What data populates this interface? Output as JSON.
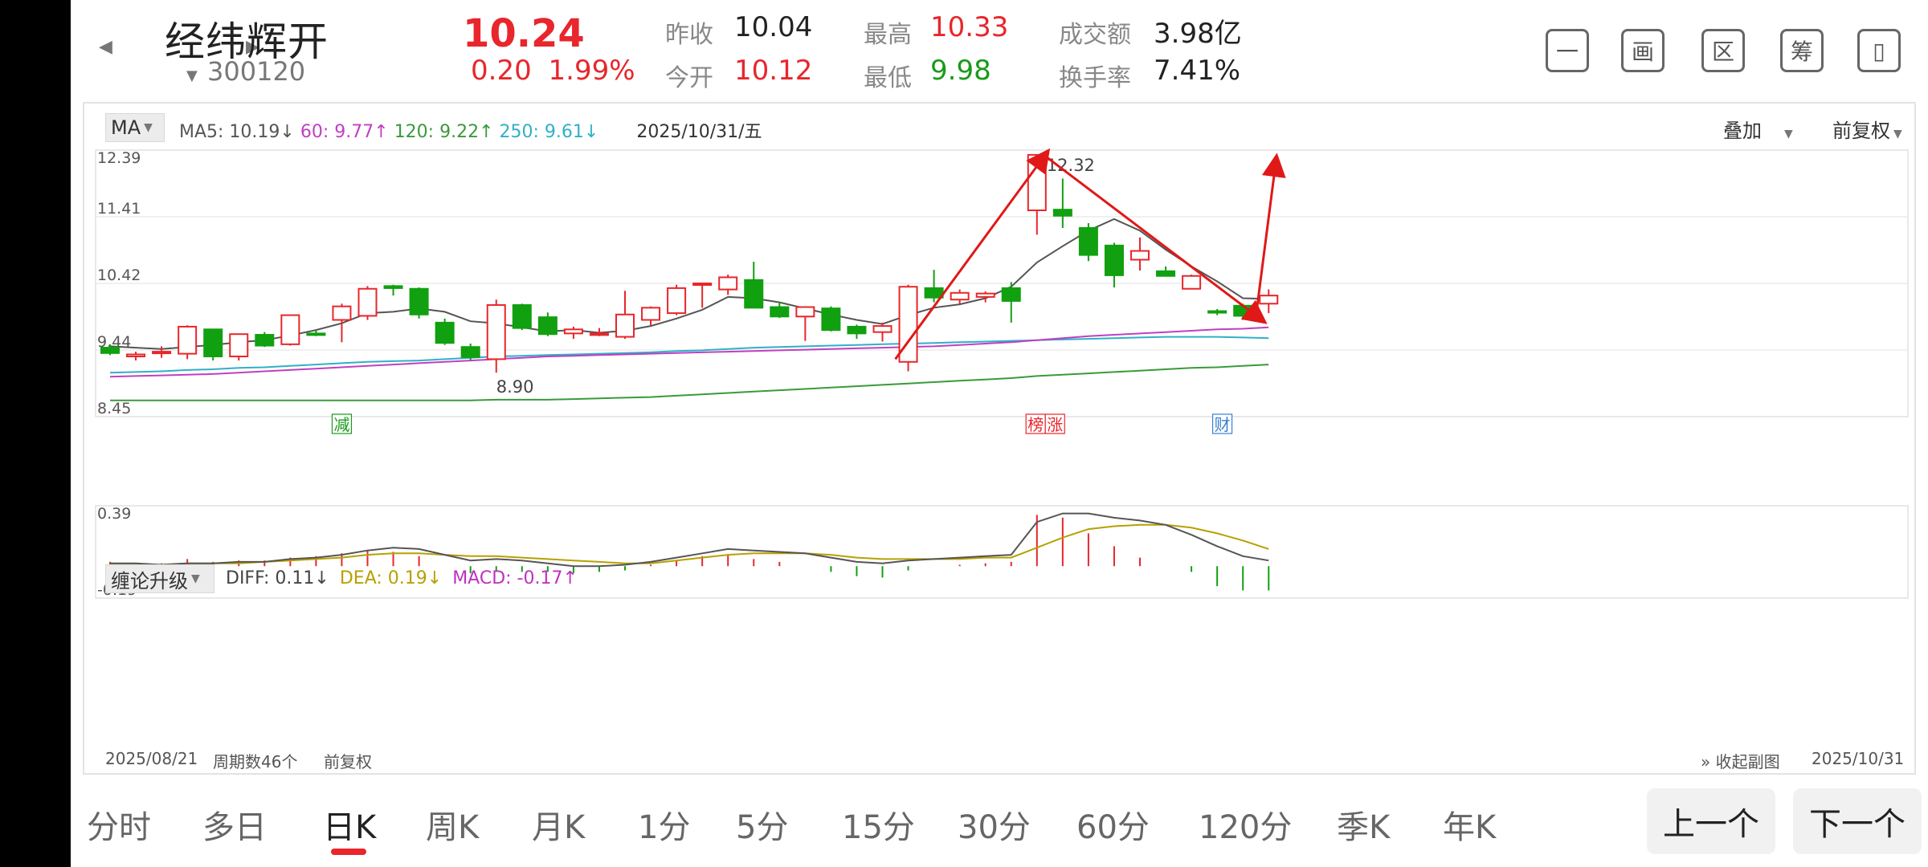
{
  "header": {
    "stock_name": "经纬辉开",
    "stock_code": "300120",
    "price": "10.24",
    "change": "0.20",
    "change_pct": "1.99%",
    "quote": {
      "prev_close_label": "昨收",
      "prev_close": "10.04",
      "open_label": "今开",
      "open": "10.12",
      "high_label": "最高",
      "high": "10.33",
      "low_label": "最低",
      "low": "9.98",
      "turnover_amt_label": "成交额",
      "turnover_amt": "3.98亿",
      "turnover_rate_label": "换手率",
      "turnover_rate": "7.41%"
    },
    "tools": [
      "一",
      "画",
      "区",
      "筹",
      "▯"
    ]
  },
  "chart": {
    "ma_selector": "MA",
    "ma5": "MA5: 10.19↓",
    "ma60": "60: 9.77↑",
    "ma120": "120: 9.22↑",
    "ma250": "250: 9.61↓",
    "date": "2025/10/31/五",
    "overlay_label": "叠加",
    "adjust_label": "前复权",
    "y_labels": [
      "12.39",
      "11.41",
      "10.42",
      "9.44",
      "8.45"
    ],
    "high_marker": "12.32",
    "low_marker": "8.90",
    "events": {
      "reduce": "减",
      "bang": "榜",
      "zhang": "涨",
      "cai": "财"
    },
    "sub_selector": "缠论升级",
    "diff": "DIFF: 0.11↓",
    "dea": "DEA: 0.19↓",
    "macd": "MACD: -0.17↑",
    "macd_top": "0.39",
    "macd_bottom": "-0.19",
    "start_date": "2025/08/21",
    "period_count": "周期数46个",
    "footer_adjust": "前复权",
    "collapse_label": "收起副图",
    "end_date": "2025/10/31"
  },
  "chart_data": {
    "type": "candlestick",
    "ylim": [
      8.45,
      12.39
    ],
    "colors": {
      "up": "#e8262b",
      "down": "#10a010",
      "ma5": "#555555",
      "ma60": "#c040c0",
      "ma120": "#3a9a3a",
      "ma250": "#30b0c8"
    },
    "candles": [
      {
        "o": 9.47,
        "h": 9.52,
        "l": 9.36,
        "c": 9.39
      },
      {
        "o": 9.34,
        "h": 9.41,
        "l": 9.28,
        "c": 9.37
      },
      {
        "o": 9.4,
        "h": 9.49,
        "l": 9.32,
        "c": 9.41
      },
      {
        "o": 9.38,
        "h": 9.8,
        "l": 9.3,
        "c": 9.78
      },
      {
        "o": 9.74,
        "h": 9.75,
        "l": 9.28,
        "c": 9.34
      },
      {
        "o": 9.34,
        "h": 9.68,
        "l": 9.28,
        "c": 9.67
      },
      {
        "o": 9.66,
        "h": 9.7,
        "l": 9.48,
        "c": 9.5
      },
      {
        "o": 9.52,
        "h": 9.96,
        "l": 9.5,
        "c": 9.95
      },
      {
        "o": 9.68,
        "h": 9.73,
        "l": 9.64,
        "c": 9.67
      },
      {
        "o": 9.88,
        "h": 10.12,
        "l": 9.55,
        "c": 10.08
      },
      {
        "o": 9.94,
        "h": 10.38,
        "l": 9.88,
        "c": 10.34
      },
      {
        "o": 10.38,
        "h": 10.4,
        "l": 10.24,
        "c": 10.35
      },
      {
        "o": 10.34,
        "h": 10.36,
        "l": 9.9,
        "c": 9.96
      },
      {
        "o": 9.84,
        "h": 9.9,
        "l": 9.51,
        "c": 9.54
      },
      {
        "o": 9.48,
        "h": 9.53,
        "l": 9.28,
        "c": 9.33
      },
      {
        "o": 9.3,
        "h": 10.18,
        "l": 9.1,
        "c": 10.1
      },
      {
        "o": 10.1,
        "h": 10.12,
        "l": 9.73,
        "c": 9.76
      },
      {
        "o": 9.92,
        "h": 9.99,
        "l": 9.64,
        "c": 9.67
      },
      {
        "o": 9.68,
        "h": 9.78,
        "l": 9.6,
        "c": 9.74
      },
      {
        "o": 9.66,
        "h": 9.76,
        "l": 9.64,
        "c": 9.68
      },
      {
        "o": 9.63,
        "h": 10.31,
        "l": 9.6,
        "c": 9.96
      },
      {
        "o": 9.88,
        "h": 10.08,
        "l": 9.8,
        "c": 10.06
      },
      {
        "o": 9.98,
        "h": 10.4,
        "l": 9.95,
        "c": 10.35
      },
      {
        "o": 10.42,
        "h": 10.43,
        "l": 10.06,
        "c": 10.42
      },
      {
        "o": 10.33,
        "h": 10.55,
        "l": 10.25,
        "c": 10.51
      },
      {
        "o": 10.47,
        "h": 10.74,
        "l": 10.07,
        "c": 10.06
      },
      {
        "o": 10.07,
        "h": 10.15,
        "l": 9.91,
        "c": 9.93
      },
      {
        "o": 9.93,
        "h": 10.08,
        "l": 9.57,
        "c": 10.07
      },
      {
        "o": 10.05,
        "h": 10.08,
        "l": 9.71,
        "c": 9.73
      },
      {
        "o": 9.78,
        "h": 9.81,
        "l": 9.6,
        "c": 9.68
      },
      {
        "o": 9.7,
        "h": 9.84,
        "l": 9.56,
        "c": 9.79
      },
      {
        "o": 9.26,
        "h": 10.4,
        "l": 9.12,
        "c": 10.37
      },
      {
        "o": 10.35,
        "h": 10.62,
        "l": 10.14,
        "c": 10.21
      },
      {
        "o": 10.18,
        "h": 10.33,
        "l": 10.12,
        "c": 10.28
      },
      {
        "o": 10.22,
        "h": 10.3,
        "l": 10.14,
        "c": 10.27
      },
      {
        "o": 10.35,
        "h": 10.44,
        "l": 9.84,
        "c": 10.16
      },
      {
        "o": 11.5,
        "h": 12.32,
        "l": 11.14,
        "c": 12.32
      },
      {
        "o": 11.51,
        "h": 11.97,
        "l": 11.24,
        "c": 11.42
      },
      {
        "o": 11.24,
        "h": 11.31,
        "l": 10.75,
        "c": 10.84
      },
      {
        "o": 10.98,
        "h": 11.02,
        "l": 10.36,
        "c": 10.54
      },
      {
        "o": 10.77,
        "h": 11.1,
        "l": 10.61,
        "c": 10.9
      },
      {
        "o": 10.6,
        "h": 10.67,
        "l": 10.52,
        "c": 10.53
      },
      {
        "o": 10.34,
        "h": 10.55,
        "l": 10.34,
        "c": 10.53
      },
      {
        "o": 10.01,
        "h": 10.04,
        "l": 9.95,
        "c": 9.99
      },
      {
        "o": 10.09,
        "h": 10.12,
        "l": 9.88,
        "c": 9.94
      },
      {
        "o": 10.12,
        "h": 10.33,
        "l": 9.98,
        "c": 10.24
      }
    ],
    "ma5": [
      9.49,
      9.47,
      9.45,
      9.48,
      9.51,
      9.55,
      9.58,
      9.65,
      9.73,
      9.83,
      9.98,
      10.0,
      10.05,
      10.0,
      9.86,
      9.83,
      9.77,
      9.71,
      9.73,
      9.69,
      9.72,
      9.79,
      9.9,
      10.03,
      10.22,
      10.2,
      10.14,
      10.05,
      9.96,
      9.88,
      9.82,
      9.95,
      10.06,
      10.11,
      10.2,
      10.37,
      10.73,
      10.97,
      11.2,
      11.37,
      11.2,
      10.92,
      10.67,
      10.45,
      10.2,
      10.19
    ],
    "ma60": [
      9.04,
      9.05,
      9.06,
      9.07,
      9.08,
      9.1,
      9.12,
      9.14,
      9.16,
      9.18,
      9.2,
      9.22,
      9.24,
      9.26,
      9.28,
      9.3,
      9.32,
      9.34,
      9.35,
      9.36,
      9.37,
      9.38,
      9.39,
      9.4,
      9.41,
      9.42,
      9.43,
      9.44,
      9.45,
      9.46,
      9.47,
      9.48,
      9.49,
      9.51,
      9.53,
      9.55,
      9.58,
      9.61,
      9.64,
      9.66,
      9.68,
      9.7,
      9.72,
      9.74,
      9.75,
      9.77
    ],
    "ma120": [
      8.69,
      8.69,
      8.69,
      8.69,
      8.69,
      8.69,
      8.69,
      8.69,
      8.69,
      8.69,
      8.69,
      8.69,
      8.69,
      8.69,
      8.69,
      8.7,
      8.7,
      8.7,
      8.71,
      8.72,
      8.73,
      8.74,
      8.76,
      8.78,
      8.8,
      8.82,
      8.84,
      8.86,
      8.88,
      8.9,
      8.92,
      8.94,
      8.96,
      8.98,
      9.0,
      9.02,
      9.05,
      9.07,
      9.09,
      9.11,
      9.13,
      9.15,
      9.17,
      9.18,
      9.2,
      9.22
    ],
    "ma250": [
      9.1,
      9.11,
      9.12,
      9.14,
      9.15,
      9.17,
      9.18,
      9.2,
      9.22,
      9.24,
      9.26,
      9.27,
      9.28,
      9.3,
      9.32,
      9.34,
      9.35,
      9.36,
      9.37,
      9.38,
      9.39,
      9.4,
      9.42,
      9.43,
      9.45,
      9.47,
      9.48,
      9.49,
      9.5,
      9.51,
      9.52,
      9.53,
      9.54,
      9.55,
      9.56,
      9.57,
      9.58,
      9.59,
      9.6,
      9.61,
      9.62,
      9.63,
      9.63,
      9.63,
      9.62,
      9.61
    ],
    "macd_ylim": [
      -0.19,
      0.39
    ],
    "diff": [
      0.02,
      0.02,
      0.01,
      0.02,
      0.02,
      0.03,
      0.03,
      0.05,
      0.06,
      0.08,
      0.11,
      0.13,
      0.12,
      0.08,
      0.04,
      0.05,
      0.04,
      0.02,
      0.0,
      0.0,
      0.01,
      0.03,
      0.06,
      0.09,
      0.12,
      0.11,
      0.1,
      0.09,
      0.06,
      0.03,
      0.02,
      0.04,
      0.05,
      0.06,
      0.07,
      0.08,
      0.31,
      0.37,
      0.37,
      0.34,
      0.32,
      0.29,
      0.22,
      0.14,
      0.07,
      0.04
    ],
    "dea": [
      0.01,
      0.01,
      0.01,
      0.02,
      0.02,
      0.02,
      0.03,
      0.04,
      0.05,
      0.06,
      0.08,
      0.09,
      0.09,
      0.08,
      0.07,
      0.07,
      0.06,
      0.05,
      0.04,
      0.03,
      0.02,
      0.02,
      0.04,
      0.06,
      0.08,
      0.09,
      0.09,
      0.09,
      0.08,
      0.06,
      0.05,
      0.05,
      0.05,
      0.05,
      0.06,
      0.06,
      0.13,
      0.2,
      0.26,
      0.28,
      0.29,
      0.29,
      0.27,
      0.23,
      0.18,
      0.12
    ],
    "macd": [
      0.03,
      0.02,
      0.02,
      0.05,
      0.03,
      0.04,
      0.04,
      0.06,
      0.07,
      0.09,
      0.11,
      0.1,
      0.07,
      0.0,
      -0.05,
      -0.03,
      -0.04,
      -0.04,
      -0.05,
      -0.04,
      -0.03,
      0.01,
      0.04,
      0.07,
      0.08,
      0.05,
      0.03,
      0.0,
      -0.04,
      -0.07,
      -0.08,
      -0.03,
      0.0,
      0.01,
      0.02,
      0.03,
      0.36,
      0.34,
      0.23,
      0.14,
      0.06,
      0.0,
      -0.04,
      -0.14,
      -0.17,
      -0.17
    ]
  },
  "tabs": [
    "分时",
    "多日",
    "日K",
    "周K",
    "月K",
    "1分",
    "5分",
    "15分",
    "30分",
    "60分",
    "120分",
    "季K",
    "年K"
  ],
  "active_tab": "日K",
  "nav": {
    "prev": "上一个",
    "next": "下一个"
  }
}
